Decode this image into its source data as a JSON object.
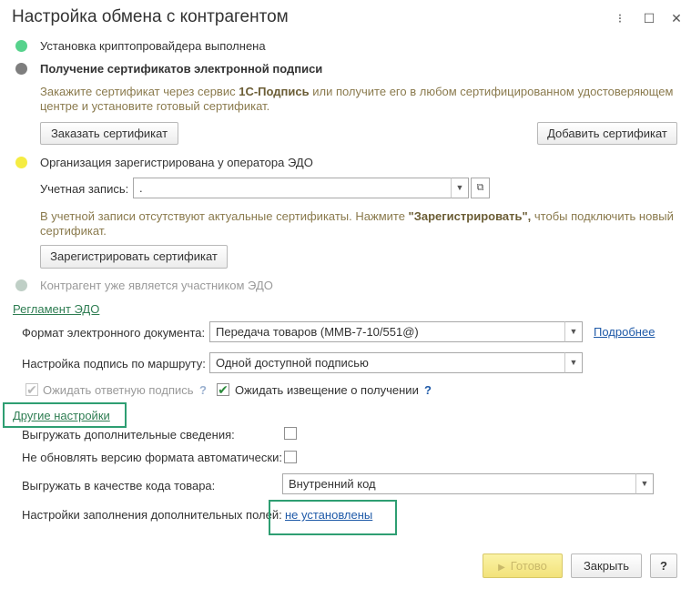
{
  "window": {
    "title": "Настройка обмена с контрагентом",
    "more_icon": "⁝",
    "maximize_icon": "☐",
    "close_icon": "✕"
  },
  "steps": {
    "crypto": {
      "label": "Установка криптопровайдера выполнена",
      "color": "#56d28c"
    },
    "certs": {
      "label": "Получение сертификатов электронной подписи",
      "color": "#7e7e7e",
      "info_part1": "Закажите сертификат через сервис ",
      "info_bold": "1С-Подпись",
      "info_part2": " или получите его в любом сертифицированном удостоверяющем",
      "info_line2": "центре и установите готовый сертификат.",
      "order_button": "Заказать сертификат",
      "add_button": "Добавить сертификат"
    },
    "registered": {
      "label": "Организация зарегистрирована у оператора ЭДО",
      "color": "#f5ec42",
      "account_label": "Учетная запись:",
      "account_value": ".",
      "info_part1": "В учетной записи отсутствуют актуальные сертификаты. Нажмите ",
      "info_bold": "\"Зарегистрировать\",",
      "info_part2": " чтобы подключить новый",
      "info_line2": "сертификат.",
      "register_button": "Зарегистрировать сертификат"
    },
    "counterparty": {
      "label": "Контрагент уже является участником ЭДО",
      "color": "#bfcfc6"
    }
  },
  "reglament": {
    "link": "Регламент ЭДО",
    "format_label": "Формат электронного документа:",
    "format_value": "Передача товаров (ММВ-7-10/551@)",
    "details_link": "Подробнее",
    "route_label": "Настройка подпись по маршруту:",
    "route_value": "Одной доступной подписью",
    "wait_reply_label": "Ожидать ответную подпись",
    "wait_reply_checked": true,
    "wait_notice_label": "Ожидать извещение о получении",
    "wait_notice_checked": true,
    "help_q": "?"
  },
  "other": {
    "link": "Другие настройки",
    "export_extra_label": "Выгружать дополнительные сведения:",
    "no_update_label": "Не обновлять версию формата автоматически:",
    "code_label": "Выгружать в качестве кода товара:",
    "code_value": "Внутренний код",
    "fill_label": "Настройки заполнения дополнительных полей:",
    "fill_link": "не установлены"
  },
  "footer": {
    "done_button": "Готово",
    "done_icon": "▶",
    "close_button": "Закрыть",
    "help_button": "?"
  },
  "highlight_color": "#2e9e72"
}
